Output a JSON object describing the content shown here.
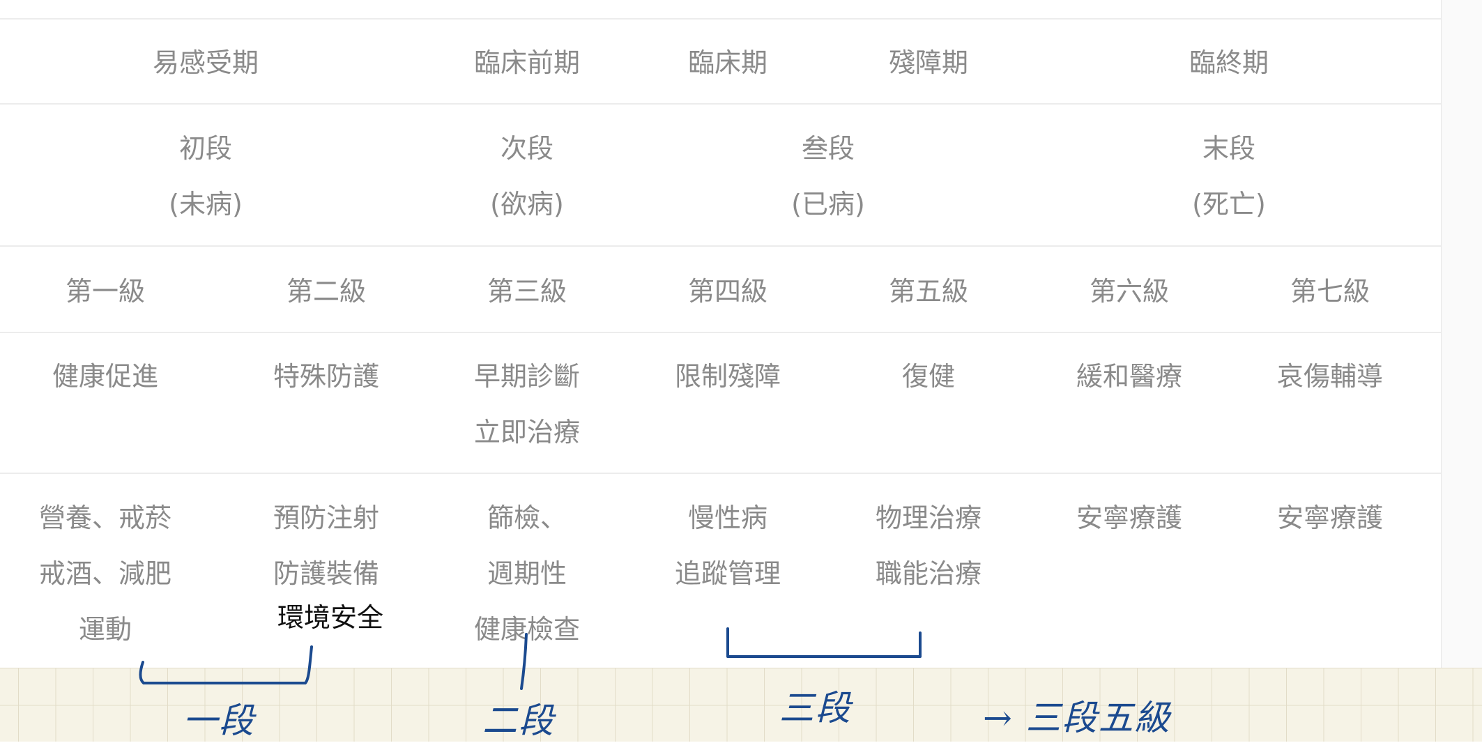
{
  "rows": {
    "stage": [
      "易感受期",
      "臨床前期",
      "臨床期",
      "殘障期",
      "臨終期"
    ],
    "segment": [
      {
        "name": "初段",
        "sub": "(未病)"
      },
      {
        "name": "次段",
        "sub": "(欲病)"
      },
      {
        "name": "叁段",
        "sub": "(已病)"
      },
      {
        "name": "末段",
        "sub": "(死亡)"
      }
    ],
    "level": [
      "第一級",
      "第二級",
      "第三級",
      "第四級",
      "第五級",
      "第六級",
      "第七級"
    ],
    "focus": [
      [
        "健康促進"
      ],
      [
        "特殊防護"
      ],
      [
        "早期診斷",
        "立即治療"
      ],
      [
        "限制殘障"
      ],
      [
        "復健"
      ],
      [
        "緩和醫療"
      ],
      [
        "哀傷輔導"
      ]
    ],
    "examples": [
      [
        "營養、戒菸",
        "戒酒、減肥",
        "運動"
      ],
      [
        "預防注射",
        "防護裝備"
      ],
      [
        "篩檢、",
        "週期性",
        "健康檢查"
      ],
      [
        "慢性病",
        "追蹤管理"
      ],
      [
        "物理治療",
        "職能治療"
      ],
      [
        "安寧療護"
      ],
      [
        "安寧療護"
      ]
    ]
  },
  "added_note": "環境安全",
  "handwriting": {
    "first": "一段",
    "second": "二段",
    "third": "三段",
    "summary": "→ 三段五級"
  },
  "colors": {
    "table_text": "#8a8a8a",
    "ink": "#1b4a8f",
    "grid_paper": "#f6f3e6"
  }
}
